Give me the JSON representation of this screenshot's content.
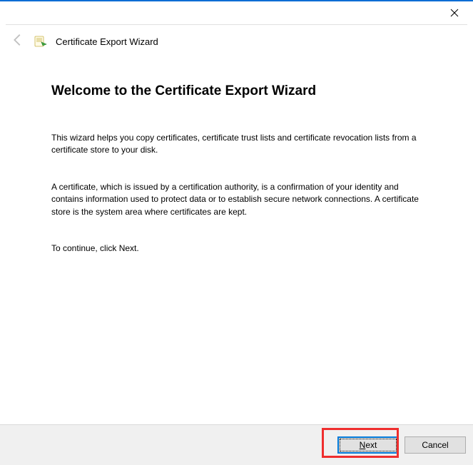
{
  "titlebar": {
    "close_label": "Close"
  },
  "header": {
    "wizard_title": "Certificate Export Wizard"
  },
  "main": {
    "heading": "Welcome to the Certificate Export Wizard",
    "para1": "This wizard helps you copy certificates, certificate trust lists and certificate revocation lists from a certificate store to your disk.",
    "para2": "A certificate, which is issued by a certification authority, is a confirmation of your identity and contains information used to protect data or to establish secure network connections. A certificate store is the system area where certificates are kept.",
    "para3": "To continue, click Next."
  },
  "footer": {
    "next_label": "Next",
    "cancel_label": "Cancel"
  }
}
